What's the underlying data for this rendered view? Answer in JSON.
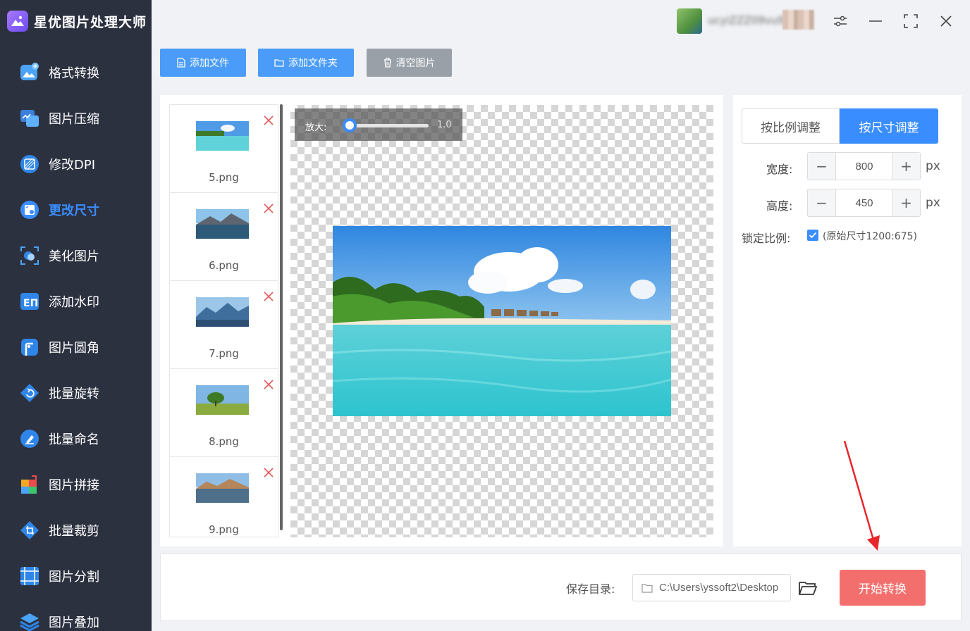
{
  "app": {
    "title": "星优图片处理大师"
  },
  "user": {
    "name": "ucyiZZZ09vu9"
  },
  "sidebar": {
    "items": [
      {
        "label": "格式转换",
        "icon": "image-convert-icon",
        "active": false
      },
      {
        "label": "图片压缩",
        "icon": "image-compress-icon",
        "active": false
      },
      {
        "label": "修改DPI",
        "icon": "dpi-icon",
        "active": false
      },
      {
        "label": "更改尺寸",
        "icon": "resize-icon",
        "active": true
      },
      {
        "label": "美化图片",
        "icon": "beautify-icon",
        "active": false
      },
      {
        "label": "添加水印",
        "icon": "watermark-icon",
        "active": false
      },
      {
        "label": "图片圆角",
        "icon": "round-corner-icon",
        "active": false
      },
      {
        "label": "批量旋转",
        "icon": "rotate-icon",
        "active": false
      },
      {
        "label": "批量命名",
        "icon": "rename-icon",
        "active": false
      },
      {
        "label": "图片拼接",
        "icon": "puzzle-icon",
        "active": false
      },
      {
        "label": "批量裁剪",
        "icon": "crop-icon",
        "active": false
      },
      {
        "label": "图片分割",
        "icon": "split-icon",
        "active": false
      },
      {
        "label": "图片叠加",
        "icon": "layers-icon",
        "active": false
      }
    ]
  },
  "toolbar": {
    "add_file": "添加文件",
    "add_folder": "添加文件夹",
    "clear_images": "清空图片"
  },
  "files": [
    {
      "name": "5.png",
      "thumb": "beach"
    },
    {
      "name": "6.png",
      "thumb": "lake-mountain"
    },
    {
      "name": "7.png",
      "thumb": "blue-mountains"
    },
    {
      "name": "8.png",
      "thumb": "tree-field"
    },
    {
      "name": "9.png",
      "thumb": "desert-lake"
    }
  ],
  "zoom": {
    "label": "放大:",
    "value": "1.0"
  },
  "settings": {
    "tab_ratio": "按比例调整",
    "tab_size": "按尺寸调整",
    "width_label": "宽度:",
    "width_value": "800",
    "height_label": "高度:",
    "height_value": "450",
    "unit": "px",
    "lock_label": "锁定比例:",
    "lock_checked": true,
    "original_size": "(原始尺寸1200:675)"
  },
  "bottom": {
    "save_label": "保存目录:",
    "path": "C:\\Users\\yssoft2\\Desktop",
    "start_button": "开始转换"
  },
  "colors": {
    "accent": "#3a8dff",
    "sidebar_bg": "#2c3140",
    "start_button": "#f26f6e"
  }
}
